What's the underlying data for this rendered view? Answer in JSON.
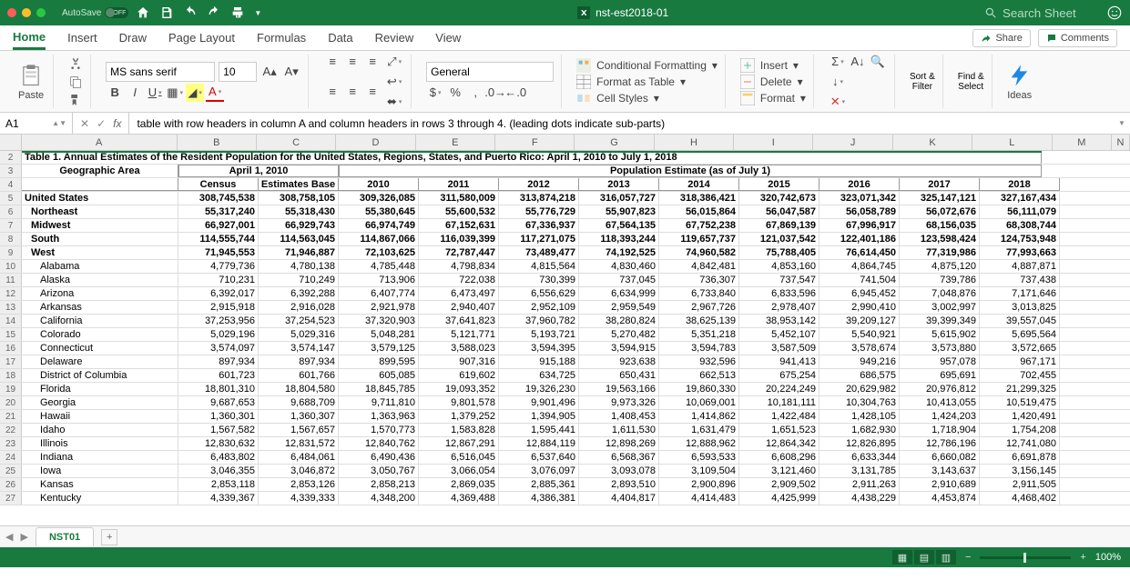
{
  "titlebar": {
    "autosave_label": "AutoSave",
    "autosave_state": "OFF",
    "filename": "nst-est2018-01",
    "search_placeholder": "Search Sheet"
  },
  "tabs": [
    "Home",
    "Insert",
    "Draw",
    "Page Layout",
    "Formulas",
    "Data",
    "Review",
    "View"
  ],
  "ribbon_right": {
    "share": "Share",
    "comments": "Comments"
  },
  "paste_label": "Paste",
  "font": {
    "name": "MS sans serif",
    "size": "10"
  },
  "number_format": "General",
  "cmds": {
    "cond_fmt": "Conditional Formatting",
    "fmt_table": "Format as Table",
    "cell_styles": "Cell Styles",
    "insert": "Insert",
    "delete": "Delete",
    "format": "Format",
    "sort": "Sort &\nFilter",
    "find": "Find &\nSelect",
    "ideas": "Ideas"
  },
  "formula_bar": {
    "ref": "A1",
    "content": "table with row headers in column A and column headers in rows 3 through 4. (leading dots indicate sub-parts)"
  },
  "columns": [
    "A",
    "B",
    "C",
    "D",
    "E",
    "F",
    "G",
    "H",
    "I",
    "J",
    "K",
    "L",
    "M",
    "N"
  ],
  "table_title": "Table 1. Annual Estimates of the Resident Population for the United States, Regions, States, and Puerto Rico: April 1, 2010 to July 1, 2018",
  "h3": {
    "geo": "Geographic Area",
    "april": "April 1, 2010",
    "pop": "Population Estimate (as of July 1)"
  },
  "h4": {
    "census": "Census",
    "estbase": "Estimates Base",
    "y2010": "2010",
    "y2011": "2011",
    "y2012": "2012",
    "y2013": "2013",
    "y2014": "2014",
    "y2015": "2015",
    "y2016": "2016",
    "y2017": "2017",
    "y2018": "2018"
  },
  "data_rows": [
    {
      "n": 5,
      "indent": 0,
      "bold": true,
      "label": "United States",
      "v": [
        "308,745,538",
        "308,758,105",
        "309,326,085",
        "311,580,009",
        "313,874,218",
        "316,057,727",
        "318,386,421",
        "320,742,673",
        "323,071,342",
        "325,147,121",
        "327,167,434"
      ]
    },
    {
      "n": 6,
      "indent": 1,
      "bold": true,
      "label": "Northeast",
      "v": [
        "55,317,240",
        "55,318,430",
        "55,380,645",
        "55,600,532",
        "55,776,729",
        "55,907,823",
        "56,015,864",
        "56,047,587",
        "56,058,789",
        "56,072,676",
        "56,111,079"
      ]
    },
    {
      "n": 7,
      "indent": 1,
      "bold": true,
      "label": "Midwest",
      "v": [
        "66,927,001",
        "66,929,743",
        "66,974,749",
        "67,152,631",
        "67,336,937",
        "67,564,135",
        "67,752,238",
        "67,869,139",
        "67,996,917",
        "68,156,035",
        "68,308,744"
      ]
    },
    {
      "n": 8,
      "indent": 1,
      "bold": true,
      "label": "South",
      "v": [
        "114,555,744",
        "114,563,045",
        "114,867,066",
        "116,039,399",
        "117,271,075",
        "118,393,244",
        "119,657,737",
        "121,037,542",
        "122,401,186",
        "123,598,424",
        "124,753,948"
      ]
    },
    {
      "n": 9,
      "indent": 1,
      "bold": true,
      "label": "West",
      "v": [
        "71,945,553",
        "71,946,887",
        "72,103,625",
        "72,787,447",
        "73,489,477",
        "74,192,525",
        "74,960,582",
        "75,788,405",
        "76,614,450",
        "77,319,986",
        "77,993,663"
      ]
    },
    {
      "n": 10,
      "indent": 2,
      "bold": false,
      "label": "Alabama",
      "v": [
        "4,779,736",
        "4,780,138",
        "4,785,448",
        "4,798,834",
        "4,815,564",
        "4,830,460",
        "4,842,481",
        "4,853,160",
        "4,864,745",
        "4,875,120",
        "4,887,871"
      ]
    },
    {
      "n": 11,
      "indent": 2,
      "bold": false,
      "label": "Alaska",
      "v": [
        "710,231",
        "710,249",
        "713,906",
        "722,038",
        "730,399",
        "737,045",
        "736,307",
        "737,547",
        "741,504",
        "739,786",
        "737,438"
      ]
    },
    {
      "n": 12,
      "indent": 2,
      "bold": false,
      "label": "Arizona",
      "v": [
        "6,392,017",
        "6,392,288",
        "6,407,774",
        "6,473,497",
        "6,556,629",
        "6,634,999",
        "6,733,840",
        "6,833,596",
        "6,945,452",
        "7,048,876",
        "7,171,646"
      ]
    },
    {
      "n": 13,
      "indent": 2,
      "bold": false,
      "label": "Arkansas",
      "v": [
        "2,915,918",
        "2,916,028",
        "2,921,978",
        "2,940,407",
        "2,952,109",
        "2,959,549",
        "2,967,726",
        "2,978,407",
        "2,990,410",
        "3,002,997",
        "3,013,825"
      ]
    },
    {
      "n": 14,
      "indent": 2,
      "bold": false,
      "label": "California",
      "v": [
        "37,253,956",
        "37,254,523",
        "37,320,903",
        "37,641,823",
        "37,960,782",
        "38,280,824",
        "38,625,139",
        "38,953,142",
        "39,209,127",
        "39,399,349",
        "39,557,045"
      ]
    },
    {
      "n": 15,
      "indent": 2,
      "bold": false,
      "label": "Colorado",
      "v": [
        "5,029,196",
        "5,029,316",
        "5,048,281",
        "5,121,771",
        "5,193,721",
        "5,270,482",
        "5,351,218",
        "5,452,107",
        "5,540,921",
        "5,615,902",
        "5,695,564"
      ]
    },
    {
      "n": 16,
      "indent": 2,
      "bold": false,
      "label": "Connecticut",
      "v": [
        "3,574,097",
        "3,574,147",
        "3,579,125",
        "3,588,023",
        "3,594,395",
        "3,594,915",
        "3,594,783",
        "3,587,509",
        "3,578,674",
        "3,573,880",
        "3,572,665"
      ]
    },
    {
      "n": 17,
      "indent": 2,
      "bold": false,
      "label": "Delaware",
      "v": [
        "897,934",
        "897,934",
        "899,595",
        "907,316",
        "915,188",
        "923,638",
        "932,596",
        "941,413",
        "949,216",
        "957,078",
        "967,171"
      ]
    },
    {
      "n": 18,
      "indent": 2,
      "bold": false,
      "label": "District of Columbia",
      "v": [
        "601,723",
        "601,766",
        "605,085",
        "619,602",
        "634,725",
        "650,431",
        "662,513",
        "675,254",
        "686,575",
        "695,691",
        "702,455"
      ]
    },
    {
      "n": 19,
      "indent": 2,
      "bold": false,
      "label": "Florida",
      "v": [
        "18,801,310",
        "18,804,580",
        "18,845,785",
        "19,093,352",
        "19,326,230",
        "19,563,166",
        "19,860,330",
        "20,224,249",
        "20,629,982",
        "20,976,812",
        "21,299,325"
      ]
    },
    {
      "n": 20,
      "indent": 2,
      "bold": false,
      "label": "Georgia",
      "v": [
        "9,687,653",
        "9,688,709",
        "9,711,810",
        "9,801,578",
        "9,901,496",
        "9,973,326",
        "10,069,001",
        "10,181,111",
        "10,304,763",
        "10,413,055",
        "10,519,475"
      ]
    },
    {
      "n": 21,
      "indent": 2,
      "bold": false,
      "label": "Hawaii",
      "v": [
        "1,360,301",
        "1,360,307",
        "1,363,963",
        "1,379,252",
        "1,394,905",
        "1,408,453",
        "1,414,862",
        "1,422,484",
        "1,428,105",
        "1,424,203",
        "1,420,491"
      ]
    },
    {
      "n": 22,
      "indent": 2,
      "bold": false,
      "label": "Idaho",
      "v": [
        "1,567,582",
        "1,567,657",
        "1,570,773",
        "1,583,828",
        "1,595,441",
        "1,611,530",
        "1,631,479",
        "1,651,523",
        "1,682,930",
        "1,718,904",
        "1,754,208"
      ]
    },
    {
      "n": 23,
      "indent": 2,
      "bold": false,
      "label": "Illinois",
      "v": [
        "12,830,632",
        "12,831,572",
        "12,840,762",
        "12,867,291",
        "12,884,119",
        "12,898,269",
        "12,888,962",
        "12,864,342",
        "12,826,895",
        "12,786,196",
        "12,741,080"
      ]
    },
    {
      "n": 24,
      "indent": 2,
      "bold": false,
      "label": "Indiana",
      "v": [
        "6,483,802",
        "6,484,061",
        "6,490,436",
        "6,516,045",
        "6,537,640",
        "6,568,367",
        "6,593,533",
        "6,608,296",
        "6,633,344",
        "6,660,082",
        "6,691,878"
      ]
    },
    {
      "n": 25,
      "indent": 2,
      "bold": false,
      "label": "Iowa",
      "v": [
        "3,046,355",
        "3,046,872",
        "3,050,767",
        "3,066,054",
        "3,076,097",
        "3,093,078",
        "3,109,504",
        "3,121,460",
        "3,131,785",
        "3,143,637",
        "3,156,145"
      ]
    },
    {
      "n": 26,
      "indent": 2,
      "bold": false,
      "label": "Kansas",
      "v": [
        "2,853,118",
        "2,853,126",
        "2,858,213",
        "2,869,035",
        "2,885,361",
        "2,893,510",
        "2,900,896",
        "2,909,502",
        "2,911,263",
        "2,910,689",
        "2,911,505"
      ]
    },
    {
      "n": 27,
      "indent": 2,
      "bold": false,
      "label": "Kentucky",
      "v": [
        "4,339,367",
        "4,339,333",
        "4,348,200",
        "4,369,488",
        "4,386,381",
        "4,404,817",
        "4,414,483",
        "4,425,999",
        "4,438,229",
        "4,453,874",
        "4,468,402"
      ]
    }
  ],
  "sheet_tab": "NST01",
  "zoom": "100%",
  "chart_data": {
    "type": "table",
    "title": "Annual Estimates of the Resident Population for the United States, Regions, States, and Puerto Rico: April 1, 2010 to July 1, 2018",
    "columns": [
      "Geographic Area",
      "Census (Apr 1 2010)",
      "Estimates Base (Apr 1 2010)",
      "2010",
      "2011",
      "2012",
      "2013",
      "2014",
      "2015",
      "2016",
      "2017",
      "2018"
    ],
    "rows": [
      [
        "United States",
        308745538,
        308758105,
        309326085,
        311580009,
        313874218,
        316057727,
        318386421,
        320742673,
        323071342,
        325147121,
        327167434
      ],
      [
        "Northeast",
        55317240,
        55318430,
        55380645,
        55600532,
        55776729,
        55907823,
        56015864,
        56047587,
        56058789,
        56072676,
        56111079
      ],
      [
        "Midwest",
        66927001,
        66929743,
        66974749,
        67152631,
        67336937,
        67564135,
        67752238,
        67869139,
        67996917,
        68156035,
        68308744
      ],
      [
        "South",
        114555744,
        114563045,
        114867066,
        116039399,
        117271075,
        118393244,
        119657737,
        121037542,
        122401186,
        123598424,
        124753948
      ],
      [
        "West",
        71945553,
        71946887,
        72103625,
        72787447,
        73489477,
        74192525,
        74960582,
        75788405,
        76614450,
        77319986,
        77993663
      ],
      [
        "Alabama",
        4779736,
        4780138,
        4785448,
        4798834,
        4815564,
        4830460,
        4842481,
        4853160,
        4864745,
        4875120,
        4887871
      ],
      [
        "Alaska",
        710231,
        710249,
        713906,
        722038,
        730399,
        737045,
        736307,
        737547,
        741504,
        739786,
        737438
      ],
      [
        "Arizona",
        6392017,
        6392288,
        6407774,
        6473497,
        6556629,
        6634999,
        6733840,
        6833596,
        6945452,
        7048876,
        7171646
      ],
      [
        "Arkansas",
        2915918,
        2916028,
        2921978,
        2940407,
        2952109,
        2959549,
        2967726,
        2978407,
        2990410,
        3002997,
        3013825
      ],
      [
        "California",
        37253956,
        37254523,
        37320903,
        37641823,
        37960782,
        38280824,
        38625139,
        38953142,
        39209127,
        39399349,
        39557045
      ],
      [
        "Colorado",
        5029196,
        5029316,
        5048281,
        5121771,
        5193721,
        5270482,
        5351218,
        5452107,
        5540921,
        5615902,
        5695564
      ],
      [
        "Connecticut",
        3574097,
        3574147,
        3579125,
        3588023,
        3594395,
        3594915,
        3594783,
        3587509,
        3578674,
        3573880,
        3572665
      ],
      [
        "Delaware",
        897934,
        897934,
        899595,
        907316,
        915188,
        923638,
        932596,
        941413,
        949216,
        957078,
        967171
      ],
      [
        "District of Columbia",
        601723,
        601766,
        605085,
        619602,
        634725,
        650431,
        662513,
        675254,
        686575,
        695691,
        702455
      ],
      [
        "Florida",
        18801310,
        18804580,
        18845785,
        19093352,
        19326230,
        19563166,
        19860330,
        20224249,
        20629982,
        20976812,
        21299325
      ],
      [
        "Georgia",
        9687653,
        9688709,
        9711810,
        9801578,
        9901496,
        9973326,
        10069001,
        10181111,
        10304763,
        10413055,
        10519475
      ],
      [
        "Hawaii",
        1360301,
        1360307,
        1363963,
        1379252,
        1394905,
        1408453,
        1414862,
        1422484,
        1428105,
        1424203,
        1420491
      ],
      [
        "Idaho",
        1567582,
        1567657,
        1570773,
        1583828,
        1595441,
        1611530,
        1631479,
        1651523,
        1682930,
        1718904,
        1754208
      ],
      [
        "Illinois",
        12830632,
        12831572,
        12840762,
        12867291,
        12884119,
        12898269,
        12888962,
        12864342,
        12826895,
        12786196,
        12741080
      ],
      [
        "Indiana",
        6483802,
        6484061,
        6490436,
        6516045,
        6537640,
        6568367,
        6593533,
        6608296,
        6633344,
        6660082,
        6691878
      ],
      [
        "Iowa",
        3046355,
        3046872,
        3050767,
        3066054,
        3076097,
        3093078,
        3109504,
        3121460,
        3131785,
        3143637,
        3156145
      ],
      [
        "Kansas",
        2853118,
        2853126,
        2858213,
        2869035,
        2885361,
        2893510,
        2900896,
        2909502,
        2911263,
        2910689,
        2911505
      ],
      [
        "Kentucky",
        4339367,
        4339333,
        4348200,
        4369488,
        4386381,
        4404817,
        4414483,
        4425999,
        4438229,
        4453874,
        4468402
      ]
    ]
  }
}
